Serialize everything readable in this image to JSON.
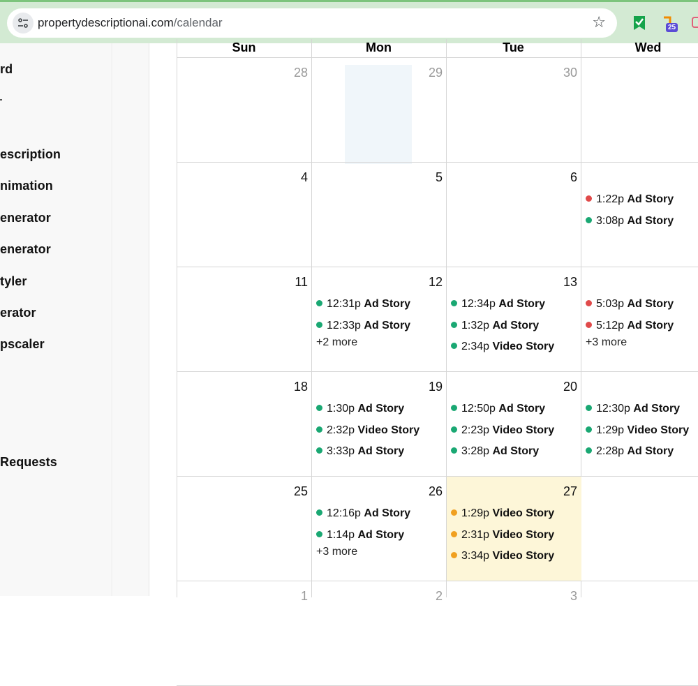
{
  "browser": {
    "url_domain": "propertydescriptionai.com",
    "url_path": "/calendar",
    "extension_badge": "25"
  },
  "sidebar": {
    "items": [
      {
        "label": "rd"
      },
      {
        "label": "escription"
      },
      {
        "label": "nimation"
      },
      {
        "label": "enerator"
      },
      {
        "label": "enerator"
      },
      {
        "label": "tyler"
      },
      {
        "label": "erator"
      },
      {
        "label": "pscaler"
      },
      {
        "label": "Requests"
      }
    ]
  },
  "calendar": {
    "days": [
      "Sun",
      "Mon",
      "Tue",
      "Wed"
    ],
    "colors": {
      "green": "#1aa873",
      "red": "#e04a4a",
      "orange": "#f0a020",
      "today_bg": "#fdf6d8"
    },
    "weeks": [
      [
        {
          "date": "28",
          "muted": true,
          "events": []
        },
        {
          "date": "29",
          "muted": true,
          "events": []
        },
        {
          "date": "30",
          "muted": true,
          "events": []
        },
        {
          "date": "",
          "events": []
        }
      ],
      [
        {
          "date": "4",
          "events": []
        },
        {
          "date": "5",
          "events": []
        },
        {
          "date": "6",
          "events": []
        },
        {
          "date": "",
          "events": [
            {
              "time": "1:22p",
              "title": "Ad Story",
              "color": "red"
            },
            {
              "time": "3:08p",
              "title": "Ad Story",
              "color": "green"
            }
          ]
        }
      ],
      [
        {
          "date": "11",
          "events": []
        },
        {
          "date": "12",
          "events": [
            {
              "time": "12:31p",
              "title": "Ad Story",
              "color": "green"
            },
            {
              "time": "12:33p",
              "title": "Ad Story",
              "color": "green"
            }
          ],
          "more": "+2 more"
        },
        {
          "date": "13",
          "events": [
            {
              "time": "12:34p",
              "title": "Ad Story",
              "color": "green"
            },
            {
              "time": "1:32p",
              "title": "Ad Story",
              "color": "green"
            },
            {
              "time": "2:34p",
              "title": "Video Story",
              "color": "green"
            }
          ]
        },
        {
          "date": "",
          "events": [
            {
              "time": "5:03p",
              "title": "Ad Story",
              "color": "red"
            },
            {
              "time": "5:12p",
              "title": "Ad Story",
              "color": "red"
            }
          ],
          "more": "+3 more"
        }
      ],
      [
        {
          "date": "18",
          "events": []
        },
        {
          "date": "19",
          "events": [
            {
              "time": "1:30p",
              "title": "Ad Story",
              "color": "green"
            },
            {
              "time": "2:32p",
              "title": "Video Story",
              "color": "green"
            },
            {
              "time": "3:33p",
              "title": "Ad Story",
              "color": "green"
            }
          ]
        },
        {
          "date": "20",
          "events": [
            {
              "time": "12:50p",
              "title": "Ad Story",
              "color": "green"
            },
            {
              "time": "2:23p",
              "title": "Video Story",
              "color": "green"
            },
            {
              "time": "3:28p",
              "title": "Ad Story",
              "color": "green"
            }
          ]
        },
        {
          "date": "",
          "events": [
            {
              "time": "12:30p",
              "title": "Ad Story",
              "color": "green"
            },
            {
              "time": "1:29p",
              "title": "Video Story",
              "color": "green"
            },
            {
              "time": "2:28p",
              "title": "Ad Story",
              "color": "green"
            }
          ]
        }
      ],
      [
        {
          "date": "25",
          "events": []
        },
        {
          "date": "26",
          "events": [
            {
              "time": "12:16p",
              "title": "Ad Story",
              "color": "green"
            },
            {
              "time": "1:14p",
              "title": "Ad Story",
              "color": "green"
            }
          ],
          "more": "+3 more"
        },
        {
          "date": "27",
          "today": true,
          "events": [
            {
              "time": "1:29p",
              "title": "Video Story",
              "color": "orange"
            },
            {
              "time": "2:31p",
              "title": "Video Story",
              "color": "orange"
            },
            {
              "time": "3:34p",
              "title": "Video Story",
              "color": "orange"
            }
          ]
        },
        {
          "date": "",
          "events": []
        }
      ],
      [
        {
          "date": "1",
          "muted": true,
          "events": []
        },
        {
          "date": "2",
          "muted": true,
          "events": []
        },
        {
          "date": "3",
          "muted": true,
          "events": []
        },
        {
          "date": "",
          "events": []
        }
      ]
    ]
  }
}
